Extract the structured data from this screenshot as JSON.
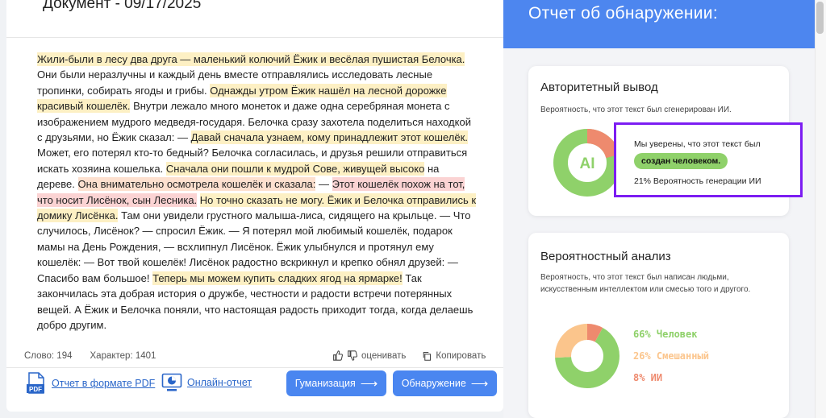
{
  "document": {
    "title": "Документ - 09/17/2025",
    "segments": [
      {
        "text": "Жили-были в лесу два друга — маленький колючий Ёжик и весёлая пушистая Белочка.",
        "hl": "y"
      },
      {
        "text": " Они были неразлучны и каждый день вместе отправлялись исследовать лесные тропинки, собирать ягоды и грибы. ",
        "hl": ""
      },
      {
        "text": "Однажды утром Ёжик нашёл на лесной дорожке красивый кошелёк.",
        "hl": "y"
      },
      {
        "text": " Внутри лежало много монеток и даже одна серебряная монета с изображением мудрого медведя-государя. Белочка сразу захотела поделиться находкой с друзьями, но Ёжик сказал: — ",
        "hl": ""
      },
      {
        "text": "Давай сначала узнаем, кому принадлежит этот кошелёк.",
        "hl": "y"
      },
      {
        "text": " Может, его потерял кто-то бедный? Белочка согласилась, и друзья решили отправиться искать хозяина кошелька. ",
        "hl": ""
      },
      {
        "text": "Сначала они пошли к мудрой Сове, живущей высоко",
        "hl": "y"
      },
      {
        "text": " на дереве. ",
        "hl": ""
      },
      {
        "text": "Она внимательно осмотрела кошелёк и сказала:",
        "hl": "o"
      },
      {
        "text": " — ",
        "hl": ""
      },
      {
        "text": "Этот кошелёк похож на тот, что носит Лисёнок, сын Лесника.",
        "hl": "p"
      },
      {
        "text": " ",
        "hl": ""
      },
      {
        "text": "Но точно сказать не могу. Ёжик и Белочка отправились к домику Лисёнка.",
        "hl": "y"
      },
      {
        "text": " Там они увидели грустного малыша-лиса, сидящего на крыльце. — Что случилось, Лисёнок? — спросил Ёжик. — Я потерял мой любимый кошелёк, подарок мамы на День Рождения, — всхлипнул Лисёнок. Ёжик улыбнулся и протянул ему кошелёк: — Вот твой кошелёк! Лисёнок радостно вскрикнул и крепко обнял друзей: — Спасибо вам большое! ",
        "hl": ""
      },
      {
        "text": "Теперь мы можем купить сладких ягод на ярмарке!",
        "hl": "y"
      },
      {
        "text": " Так закончилась эта добрая история о дружбе, честности и радости встречи потерянных вещей. А Ёжик и Белочка поняли, что настоящая радость приходит тогда, когда делаешь добро другим.",
        "hl": ""
      }
    ],
    "word_count": "Слово: 194",
    "char_count": "Характер: 1401",
    "rate_label": "оценивать",
    "copy_label": "Копировать",
    "pdf_link": "Отчет в формате PDF",
    "pdf_icon_text": "PDF",
    "online_link": "Онлайн-отчет",
    "humanize_btn": "Гуманизация",
    "detect_btn": "Обнаружение"
  },
  "report": {
    "title": "Отчет об обнаружении:",
    "authoritative": {
      "title": "Авторитетный вывод",
      "subtitle": "Вероятность, что этот текст был сгенерирован ИИ.",
      "gauge_label": "AI",
      "ai_fraction": 0.21,
      "verdict_line1": "Мы уверены, что этот текст был",
      "verdict_badge": "создан человеком.",
      "verdict_line3": "21% Вероятность генерации ИИ"
    },
    "probabilistic": {
      "title": "Вероятностный анализ",
      "subtitle": "Вероятность, что этот текст был написан людьми, искусственным интеллектом или смесью того и другого.",
      "segments": [
        {
          "label": "66% Человек",
          "value": 66,
          "color": "#8fd16a"
        },
        {
          "label": "26% Смешанный",
          "value": 26,
          "color": "#fbc58c"
        },
        {
          "label": "8% ИИ",
          "value": 8,
          "color": "#ee8a6e"
        }
      ]
    }
  },
  "colors": {
    "accent": "#4d86ef",
    "human": "#8fd16a",
    "ai": "#ee8a6e",
    "highlight_box": "#7c1df2"
  }
}
